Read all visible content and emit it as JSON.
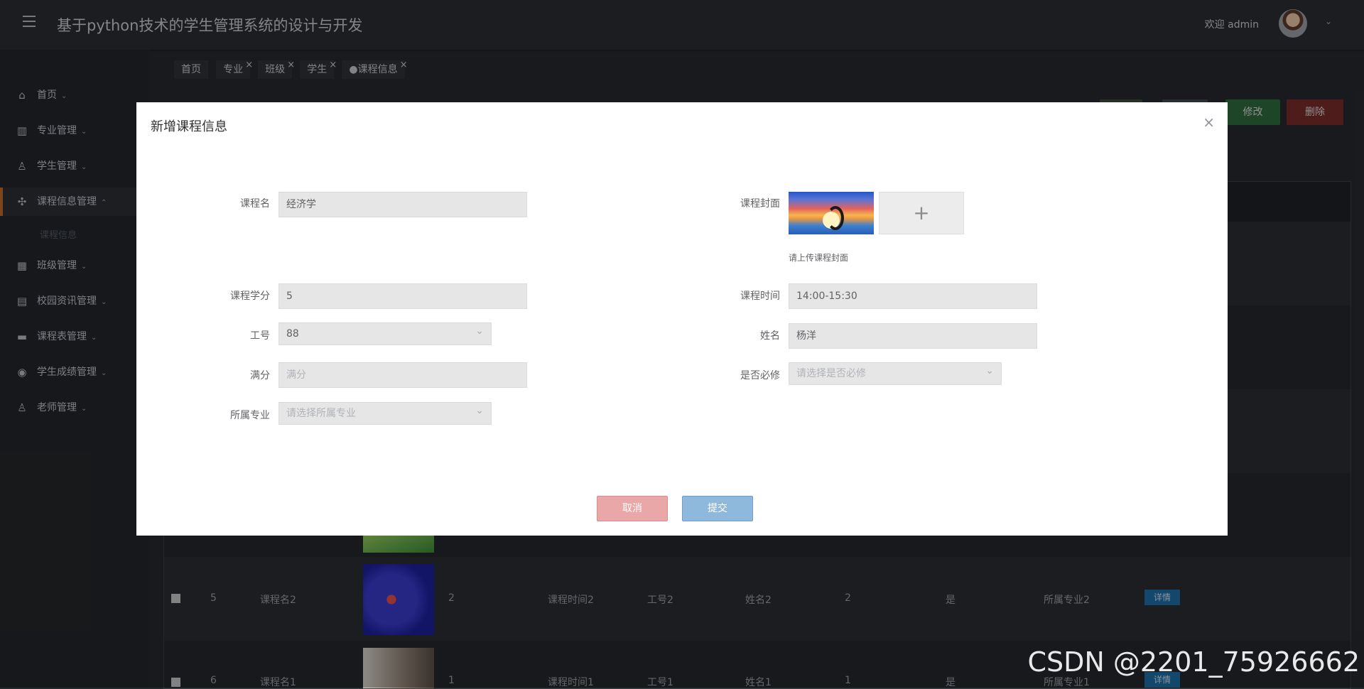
{
  "header": {
    "title": "基于python技术的学生管理系统的设计与开发",
    "welcome": "欢迎 admin",
    "menu_icon": "hamburger-icon",
    "avatar_caret": "⌄"
  },
  "sidebar": {
    "items": [
      {
        "label": "首页",
        "icon": "home-icon",
        "glyph": "⌂",
        "caret": "⌄"
      },
      {
        "label": "专业管理",
        "icon": "chart-icon",
        "glyph": "▥",
        "caret": "⌄"
      },
      {
        "label": "学生管理",
        "icon": "user-icon",
        "glyph": "♙",
        "caret": "⌄"
      },
      {
        "label": "课程信息管理",
        "icon": "apps-icon",
        "glyph": "✣",
        "caret": "⌃"
      },
      {
        "label": "班级管理",
        "icon": "building-icon",
        "glyph": "▦",
        "caret": "⌄"
      },
      {
        "label": "校园资讯管理",
        "icon": "news-icon",
        "glyph": "▤",
        "caret": "⌄"
      },
      {
        "label": "课程表管理",
        "icon": "calendar-icon",
        "glyph": "▬",
        "caret": "⌄"
      },
      {
        "label": "学生成绩管理",
        "icon": "target-icon",
        "glyph": "◉",
        "caret": "⌄"
      },
      {
        "label": "老师管理",
        "icon": "person-icon",
        "glyph": "♙",
        "caret": "⌄"
      }
    ],
    "sub_item": "课程信息"
  },
  "tabs": [
    {
      "label": "首页",
      "closable": false
    },
    {
      "label": "专业",
      "closable": true
    },
    {
      "label": "班级",
      "closable": true
    },
    {
      "label": "学生",
      "closable": true
    },
    {
      "label": "●课程信息",
      "closable": true
    }
  ],
  "toolbar": {
    "edit_label": "修改",
    "delete_label": "删除",
    "colors": {
      "edit": "#2f6b3e",
      "delete": "#7a2c2c"
    }
  },
  "background_table": {
    "rows": [
      {
        "checkbox": "",
        "id": "5",
        "name": "课程名2",
        "credit": "2",
        "time": "课程时间2",
        "teacher_id": "工号2",
        "teacher": "姓名2",
        "full": "2",
        "required": "是",
        "major": "所属专业2",
        "action": "详情"
      },
      {
        "checkbox": "",
        "id": "6",
        "name": "课程名1",
        "credit": "1",
        "time": "课程时间1",
        "teacher_id": "工号1",
        "teacher": "姓名1",
        "full": "1",
        "required": "是",
        "major": "所属专业1",
        "action": "详情"
      }
    ]
  },
  "modal": {
    "title": "新增课程信息",
    "close_icon": "×",
    "fields": {
      "course_name": {
        "label": "课程名",
        "value": "经济学"
      },
      "credit": {
        "label": "课程学分",
        "value": "5"
      },
      "teacher_id": {
        "label": "工号",
        "value": "88"
      },
      "full_score": {
        "label": "满分",
        "value": "",
        "placeholder": "满分"
      },
      "major": {
        "label": "所属专业",
        "value": "",
        "placeholder": "请选择所属专业"
      },
      "cover": {
        "label": "课程封面",
        "hint": "请上传课程封面",
        "upload_symbol": "+"
      },
      "course_time": {
        "label": "课程时间",
        "value": "14:00-15:30"
      },
      "teacher_name": {
        "label": "姓名",
        "value": "杨洋"
      },
      "required": {
        "label": "是否必修",
        "value": "",
        "placeholder": "请选择是否必修"
      }
    },
    "cancel_label": "取消",
    "submit_label": "提交"
  },
  "watermark": "CSDN @2201_75926662"
}
